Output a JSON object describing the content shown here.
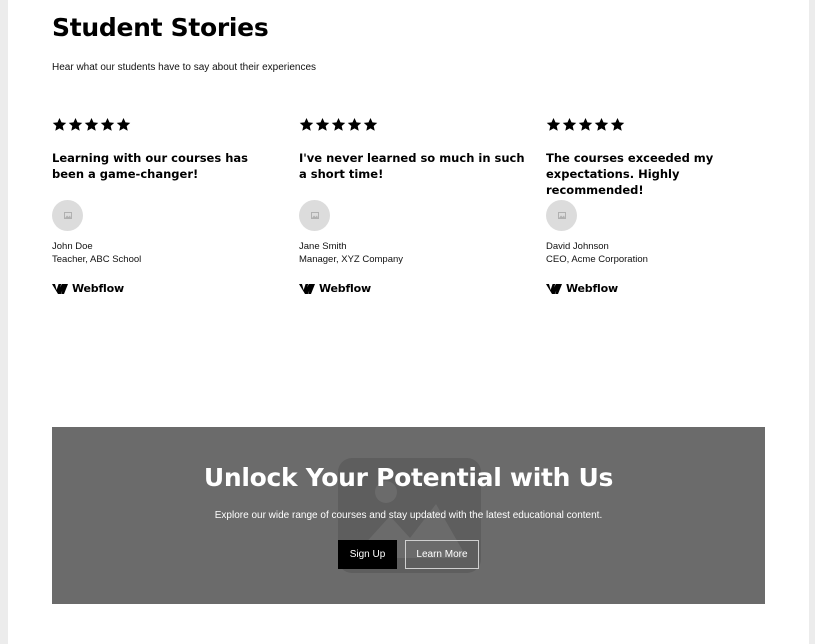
{
  "testimonials_section": {
    "title": "Student Stories",
    "subtitle": "Hear what our students have to say about their experiences",
    "rating_stars": 5,
    "cards": [
      {
        "quote": "Learning with our courses has been a game-changer!",
        "name": "John Doe",
        "role": "Teacher, ABC School",
        "company_logo": "Webflow"
      },
      {
        "quote": "I've never learned so much in such a short time!",
        "name": "Jane Smith",
        "role": "Manager, XYZ Company",
        "company_logo": "Webflow"
      },
      {
        "quote": "The courses exceeded my expectations. Highly recommended!",
        "name": "David Johnson",
        "role": "CEO, Acme Corporation",
        "company_logo": "Webflow"
      }
    ]
  },
  "cta_section": {
    "heading": "Unlock Your Potential with Us",
    "text": "Explore our wide range of courses and stay updated with the latest educational content.",
    "primary_button": "Sign Up",
    "secondary_button": "Learn More",
    "background_icon": "image-placeholder-icon"
  },
  "colors": {
    "cta_background": "#6b6b6b",
    "primary_button": "#000000",
    "avatar_placeholder": "#dcdcdc"
  }
}
